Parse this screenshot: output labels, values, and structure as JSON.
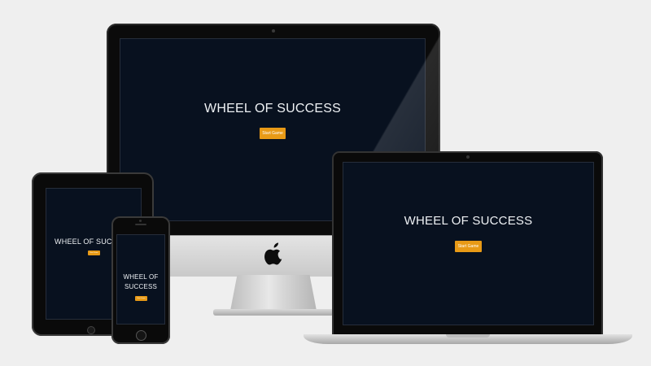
{
  "app": {
    "title": "WHEEL OF SUCCESS",
    "title_line1": "WHEEL OF",
    "title_line2": "SUCCESS",
    "start_button_label": "Start Game",
    "accent_color": "#e89a16",
    "screen_color": "#08111f"
  },
  "devices": {
    "desktop": {
      "name": "desktop-monitor",
      "logo_icon": "apple-logo-icon"
    },
    "laptop": {
      "name": "laptop"
    },
    "tablet": {
      "name": "tablet"
    },
    "phone": {
      "name": "phone"
    }
  }
}
